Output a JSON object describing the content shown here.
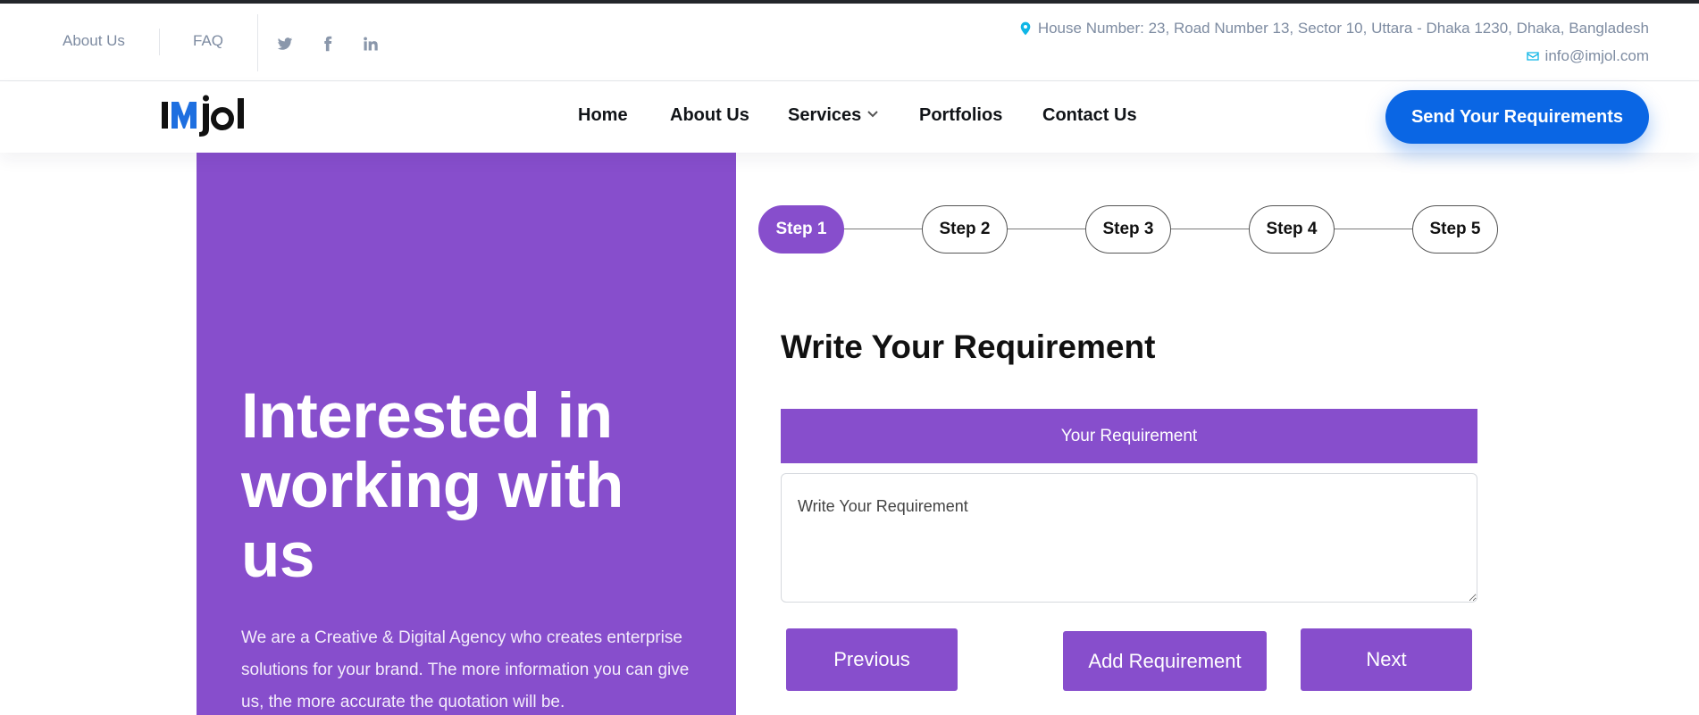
{
  "topbar": {
    "about_label": "About Us",
    "faq_label": "FAQ",
    "address": "House Number: 23, Road Number 13, Sector 10, Uttara - Dhaka 1230, Dhaka, Bangladesh",
    "email": "info@imjol.com",
    "social_icons": [
      "twitter-icon",
      "facebook-icon",
      "linkedin-icon"
    ]
  },
  "brand": {
    "logo_text": "Imjol",
    "accent": "#874ecc",
    "cta_blue": "#0a66e4",
    "contact_icon_color": "#0fb6e6"
  },
  "nav": {
    "items": [
      {
        "label": "Home"
      },
      {
        "label": "About Us"
      },
      {
        "label": "Services"
      },
      {
        "label": "Portfolios"
      },
      {
        "label": "Contact Us"
      }
    ],
    "cta_label": "Send Your Requirements"
  },
  "hero": {
    "title": "Interested in working with us",
    "description": "We are a Creative & Digital Agency who creates enterprise solutions for your brand. The more information you can give us, the more accurate the quotation will be."
  },
  "steps": [
    {
      "label": "Step 1",
      "active": true
    },
    {
      "label": "Step 2",
      "active": false
    },
    {
      "label": "Step 3",
      "active": false
    },
    {
      "label": "Step 4",
      "active": false
    },
    {
      "label": "Step 5",
      "active": false
    }
  ],
  "form": {
    "title": "Write Your Requirement",
    "section_header": "Your Requirement",
    "textarea_placeholder": "Write Your Requirement",
    "textarea_value": "",
    "prev_label": "Previous",
    "add_label": "Add Requirement",
    "next_label": "Next"
  }
}
